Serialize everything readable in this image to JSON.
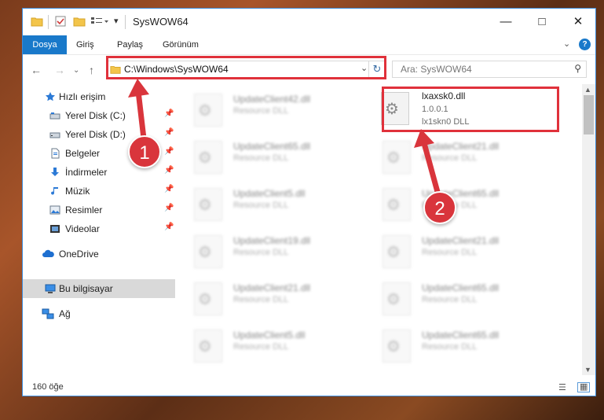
{
  "window": {
    "title": "SysWOW64"
  },
  "ribbon": {
    "tabs": [
      {
        "label": "Dosya"
      },
      {
        "label": "Giriş"
      },
      {
        "label": "Paylaş"
      },
      {
        "label": "Görünüm"
      }
    ]
  },
  "address": {
    "path": "C:\\Windows\\SysWOW64"
  },
  "search": {
    "placeholder": "Ara: SysWOW64"
  },
  "sidebar": {
    "items": [
      {
        "label": "Hızlı erişim",
        "icon": "star-icon"
      },
      {
        "label": "Yerel Disk (C:)",
        "icon": "drive-icon",
        "pinned": true
      },
      {
        "label": "Yerel Disk (D:)",
        "icon": "drive-icon",
        "pinned": true
      },
      {
        "label": "Belgeler",
        "icon": "document-icon",
        "pinned": true
      },
      {
        "label": "İndirmeler",
        "icon": "download-icon",
        "pinned": true
      },
      {
        "label": "Müzik",
        "icon": "music-icon",
        "pinned": true
      },
      {
        "label": "Resimler",
        "icon": "picture-icon",
        "pinned": true
      },
      {
        "label": "Videolar",
        "icon": "video-icon",
        "pinned": true
      },
      {
        "label": "OneDrive",
        "icon": "cloud-icon"
      },
      {
        "label": "Bu bilgisayar",
        "icon": "computer-icon",
        "selected": true
      },
      {
        "label": "Ağ",
        "icon": "network-icon"
      }
    ]
  },
  "files": {
    "left_column": [
      {
        "name": "UpdateClient42.dll",
        "type": "Resource DLL"
      },
      {
        "name": "UpdateClient65.dll",
        "type": "Resource DLL"
      },
      {
        "name": "UpdateClient5.dll",
        "type": "Resource DLL"
      },
      {
        "name": "UpdateClient19.dll",
        "type": "Resource DLL"
      },
      {
        "name": "UpdateClient21.dll",
        "type": "Resource DLL"
      },
      {
        "name": "UpdateClient5.dll",
        "type": "Resource DLL"
      }
    ],
    "right_column": [
      {
        "name": "UpdateClient21.dll",
        "type": "Resource DLL"
      },
      {
        "name": "UpdateClient65.dll",
        "type": "Resource DLL"
      },
      {
        "name": "UpdateClient21.dll",
        "type": "Resource DLL"
      },
      {
        "name": "UpdateClient65.dll",
        "type": "Resource DLL"
      },
      {
        "name": "UpdateClient65.dll",
        "type": "Resource DLL"
      }
    ],
    "highlighted": {
      "name": "lxaxsk0.dll",
      "version": "1.0.0.1",
      "description": "lx1skn0 DLL"
    }
  },
  "status": {
    "count": "160 öğe"
  },
  "annotations": {
    "callout1": "1",
    "callout2": "2",
    "color": "#d9353c"
  },
  "colors": {
    "accent": "#1979ca",
    "highlight_border": "#e0313b"
  }
}
